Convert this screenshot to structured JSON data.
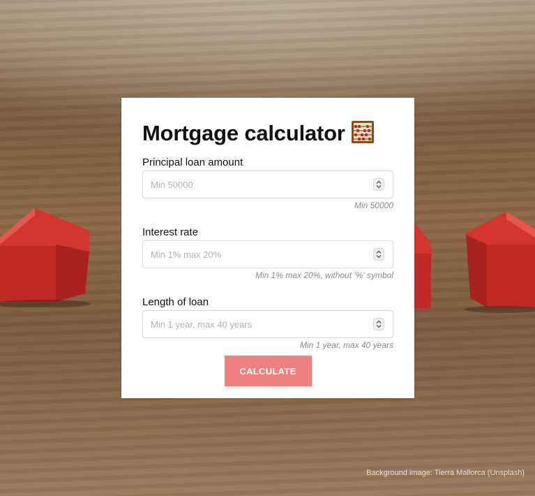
{
  "title": "Mortgage calculator",
  "title_icon": "abacus-icon",
  "fields": [
    {
      "label": "Principal loan amount",
      "placeholder": "Min 50000",
      "value": "",
      "hint": "Min 50000"
    },
    {
      "label": "Interest rate",
      "placeholder": "Min 1% max 20%",
      "value": "",
      "hint": "Min 1% max 20%, without '%' symbol"
    },
    {
      "label": "Length of loan",
      "placeholder": "Min 1 year, max 40 years",
      "value": "",
      "hint": "Min 1 year, max 40 years"
    }
  ],
  "button": {
    "label": "CALCULATE",
    "color": "#f08080"
  },
  "credit": "Background image: Tierra Mallorca (Unsplash)",
  "colors": {
    "card": "#ffffff",
    "house": "#c8302c",
    "accent": "#f08080"
  }
}
